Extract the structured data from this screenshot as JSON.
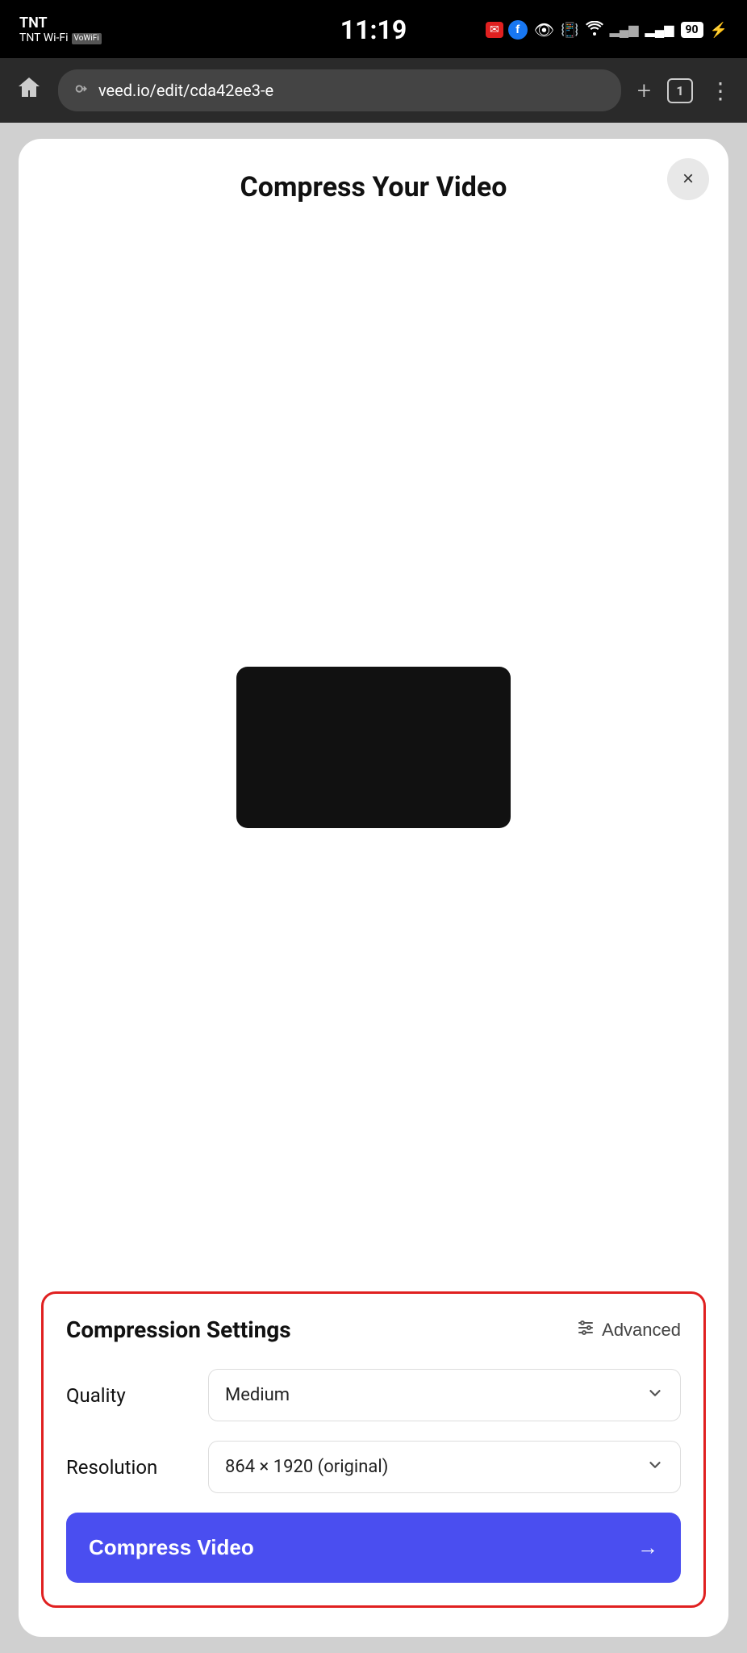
{
  "statusBar": {
    "carrier": "TNT",
    "carrierSub": "TNT Wi-Fi",
    "volte": "VoWiFi",
    "time": "11:19",
    "battery": "90",
    "icons": {
      "eye": "👁",
      "vibrate": "📳",
      "wifi": "WiFi",
      "signal1": "▂▄",
      "signal2": "▂▄▆",
      "thunder": "⚡"
    }
  },
  "browser": {
    "homeIcon": "⌂",
    "url": "veed.io/edit/cda42ee3-e",
    "plusIcon": "+",
    "tabCount": "1",
    "menuIcon": "⋮",
    "urlIcon": "⇄"
  },
  "modal": {
    "title": "Compress Your Video",
    "closeLabel": "×",
    "settings": {
      "title": "Compression Settings",
      "advancedLabel": "Advanced",
      "advancedIcon": "⇌",
      "quality": {
        "label": "Quality",
        "value": "Medium",
        "chevron": "⌄"
      },
      "resolution": {
        "label": "Resolution",
        "value": "864 × 1920 (original)",
        "chevron": "⌄"
      }
    },
    "compressBtn": {
      "label": "Compress Video",
      "arrow": "→"
    }
  }
}
